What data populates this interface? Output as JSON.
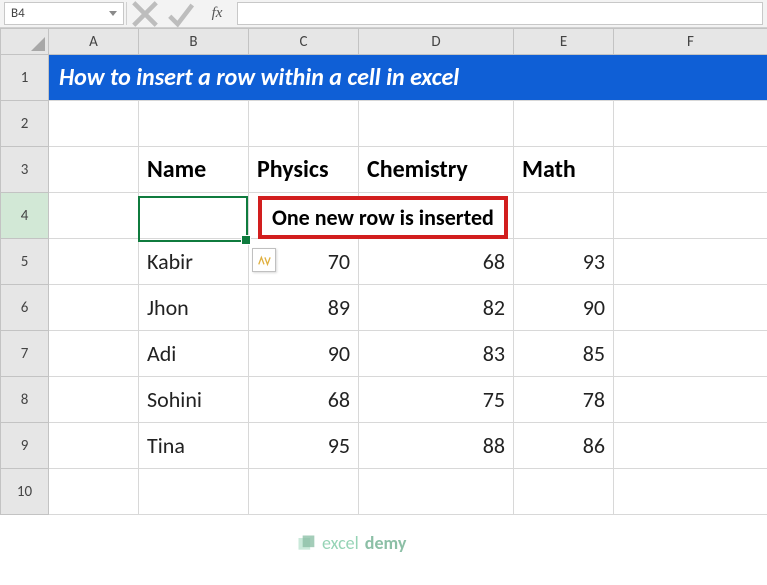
{
  "nameBox": "B4",
  "fx_label": "fx",
  "columns": [
    "A",
    "B",
    "C",
    "D",
    "E",
    "F"
  ],
  "rowNumbers": [
    "1",
    "2",
    "3",
    "4",
    "5",
    "6",
    "7",
    "8",
    "9",
    "10"
  ],
  "banner": "How to insert a row within a cell in excel",
  "headers": {
    "name": "Name",
    "phys": "Physics",
    "chem": "Chemistry",
    "math": "Math"
  },
  "callout": "One new row is inserted",
  "data": [
    {
      "name": "Kabir",
      "phys": "70",
      "chem": "68",
      "math": "93"
    },
    {
      "name": "Jhon",
      "phys": "89",
      "chem": "82",
      "math": "90"
    },
    {
      "name": "Adi",
      "phys": "90",
      "chem": "83",
      "math": "85"
    },
    {
      "name": "Sohini",
      "phys": "68",
      "chem": "75",
      "math": "78"
    },
    {
      "name": "Tina",
      "phys": "95",
      "chem": "88",
      "math": "86"
    }
  ],
  "watermark": {
    "a": "excel",
    "b": "demy"
  },
  "chart_data": {
    "type": "table",
    "title": "How to insert a row within a cell in excel",
    "columns": [
      "Name",
      "Physics",
      "Chemistry",
      "Math"
    ],
    "rows": [
      [
        "Kabir",
        70,
        68,
        93
      ],
      [
        "Jhon",
        89,
        82,
        90
      ],
      [
        "Adi",
        90,
        83,
        85
      ],
      [
        "Sohini",
        68,
        75,
        78
      ],
      [
        "Tina",
        95,
        88,
        86
      ]
    ]
  }
}
